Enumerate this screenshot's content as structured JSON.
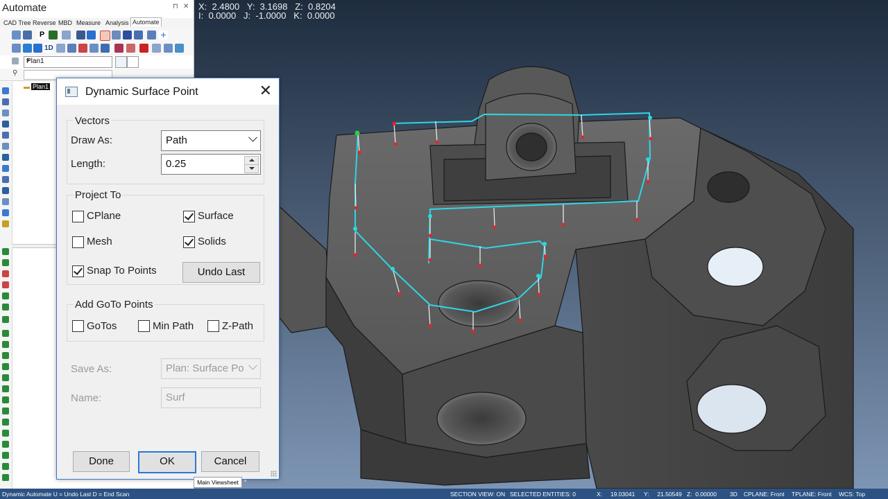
{
  "viewport": {
    "coord_line1": "X:  2.4800   Y:  3.1698   Z:  0.8204",
    "coord_line2": "I:  0.0000   J:  -1.0000   K:  0.0000"
  },
  "left_panel": {
    "title": "Automate",
    "pin_icon": "pin-icon",
    "close_label": "✕",
    "tabs": [
      "CAD Tree",
      "Reverse",
      "MBD",
      "Measure",
      "Analysis",
      "Automate"
    ],
    "active_tab": "Automate",
    "plan_select_value": "Plan1",
    "tree_node_label": "Plan1"
  },
  "dialog": {
    "title": "Dynamic Surface Point",
    "close_label": "✕",
    "vectors": {
      "group_label": "Vectors",
      "draw_as_label": "Draw As:",
      "draw_as_value": "Path",
      "length_label": "Length:",
      "length_value": "0.25"
    },
    "project_to": {
      "group_label": "Project To",
      "cplane_label": "CPlane",
      "cplane_checked": false,
      "surface_label": "Surface",
      "surface_checked": true,
      "mesh_label": "Mesh",
      "mesh_checked": false,
      "solids_label": "Solids",
      "solids_checked": true,
      "snap_label": "Snap To Points",
      "snap_checked": true,
      "undo_last_label": "Undo Last"
    },
    "goto_points": {
      "group_label": "Add GoTo Points",
      "gotos_label": "GoTos",
      "minpath_label": "Min Path",
      "zpath_label": "Z-Path"
    },
    "save_as_label": "Save As:",
    "save_as_value": "Plan: Surface Po",
    "name_label": "Name:",
    "name_value": "Surf",
    "done_label": "Done",
    "ok_label": "OK",
    "cancel_label": "Cancel"
  },
  "sheet_tab": {
    "label": "Main Viewsheet",
    "add_label": "+"
  },
  "statusbar": {
    "left": "Dynamic Automate  U = Undo Last D = End Scan",
    "section_view": "SECTION VIEW: ON",
    "selected": "SELECTED ENTITIES: 0",
    "x": "X:     19.03041",
    "y": "Y:     21.50549",
    "z": "Z:  0.00000",
    "mode": "3D",
    "cplane": "CPLANE: Front",
    "tplane": "TPLANE: Front",
    "wcs": "WCS: Top"
  },
  "colors": {
    "path": "#2fd6e6",
    "point_red": "#e8222a",
    "point_green": "#27d43b",
    "status_bar": "#2b5283",
    "dialog_border": "#3b78c0",
    "background_top": "#1e2c3e",
    "background_bottom": "#7d95b4"
  }
}
